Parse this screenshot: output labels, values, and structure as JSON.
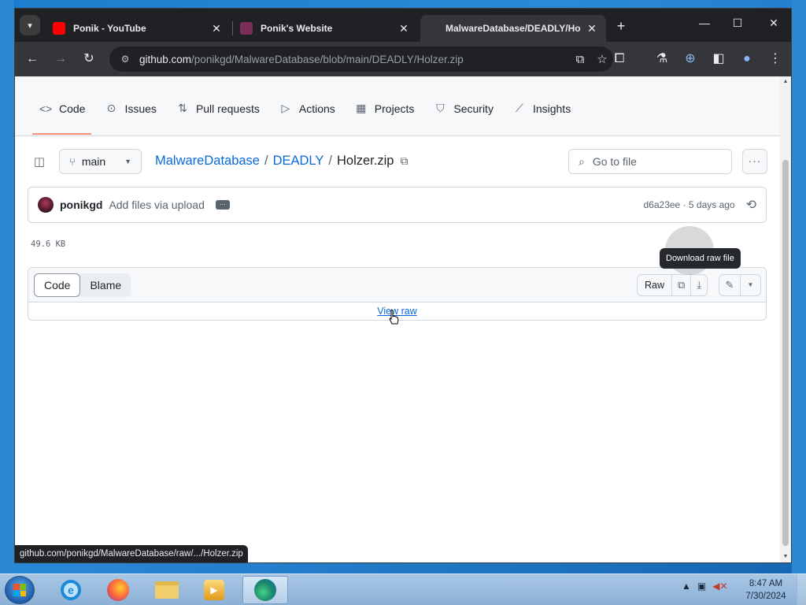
{
  "browser": {
    "tabs": [
      {
        "title": "Ponik - YouTube",
        "icon": "youtube-icon",
        "color": "#ff0000"
      },
      {
        "title": "Ponik's Website",
        "icon": "site-favicon",
        "color": "#7a2f5a"
      },
      {
        "title": "MalwareDatabase/DEADLY/Ho",
        "icon": "github-icon",
        "color": "#e8eaed",
        "active": true
      }
    ],
    "url_host": "github.com",
    "url_path": "/ponikgd/MalwareDatabase/blob/main/DEADLY/Holzer.zip",
    "status_url": "github.com/ponikgd/MalwareDatabase/raw/.../Holzer.zip"
  },
  "repo_nav": {
    "items": [
      {
        "label": "Code",
        "icon": "code-icon",
        "selected": true
      },
      {
        "label": "Issues",
        "icon": "issue-icon"
      },
      {
        "label": "Pull requests",
        "icon": "pull-request-icon"
      },
      {
        "label": "Actions",
        "icon": "play-icon"
      },
      {
        "label": "Projects",
        "icon": "table-icon"
      },
      {
        "label": "Security",
        "icon": "shield-icon"
      },
      {
        "label": "Insights",
        "icon": "graph-icon"
      }
    ]
  },
  "file_header": {
    "branch": "main",
    "breadcrumb": {
      "repo": "MalwareDatabase",
      "folder": "DEADLY",
      "separator": "/",
      "file": "Holzer.zip"
    },
    "goto_placeholder": "Go to file"
  },
  "commit": {
    "author": "ponikgd",
    "message": "Add files via upload",
    "meta": "d6a23ee · 5 days ago"
  },
  "file_size": "49.6 KB",
  "code_panel": {
    "tabs": [
      "Code",
      "Blame"
    ],
    "raw_label": "Raw",
    "view_raw": "View raw",
    "tooltip": "Download raw file"
  },
  "taskbar": {
    "time": "8:47 AM",
    "date": "7/30/2024"
  },
  "colors": {
    "accent_link": "#0969da",
    "nav_underline": "#fd8c73"
  }
}
